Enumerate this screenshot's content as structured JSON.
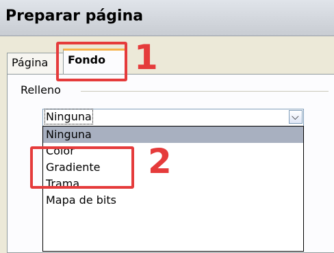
{
  "window": {
    "title": "Preparar página"
  },
  "tabs": [
    {
      "label": "Página"
    },
    {
      "label": "Fondo"
    }
  ],
  "fill_group": {
    "label": "Relleno",
    "dropdown": {
      "selected_value": "Ninguna",
      "options": [
        "Ninguna",
        "Color",
        "Gradiente",
        "Trama",
        "Mapa de bits"
      ],
      "highlighted_index": 0
    }
  },
  "annotations": {
    "callout_1": "1",
    "callout_2": "2",
    "color": "#e53b3b"
  }
}
